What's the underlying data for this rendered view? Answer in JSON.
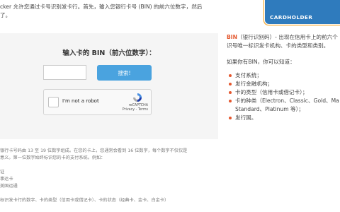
{
  "intro": {
    "line1": "cker 允许您通过卡号识别发卡行。首先，输入您银行卡号 (BIN) 的前六位数字，然后",
    "line2": "了。"
  },
  "form": {
    "title": "输入卡的 BIN（前六位数字）：",
    "bin_value": "",
    "search_label": "搜索!",
    "recaptcha_label": "I'm not a robot",
    "recaptcha_brand": "reCAPTCHA",
    "recaptcha_links": "Privacy - Terms"
  },
  "note": {
    "lines": [
      "银行卡号码由 13 至 19 位数字组成。在您的卡上，您通常会看到 16 位数字，每个数字不仅仅是",
      "意义。第一位数字始终标识您的卡的支付系统。例如：",
      "",
      "证",
      "事达卡",
      "美国运通",
      "",
      "标识发卡行的数字、卡的类型（信用卡或借记卡）、卡的状态（经典卡、金卡、白金卡）"
    ]
  },
  "card": {
    "label": "CARDHOLDER"
  },
  "sidebar": {
    "bin_term": "BIN",
    "desc_rest": "（银行识别码）- 出现在信用卡上的前六个",
    "desc_line2": "识号唯一标识发卡机构、卡的类型和类别。",
    "subtitle": "如果你有BIN，你可以知道：",
    "items": [
      "支付系统；",
      "发行金融机构；",
      "卡的类型（信用卡或借记卡）；",
      "卡的种类（Electron、Classic、Gold、Ma",
      "Standard、Platinum 等）；",
      "发行国。"
    ]
  },
  "colors": {
    "accent": "#e4572e",
    "button": "#4aa3df",
    "card": "#2f7bbd",
    "card_border": "#f39c12"
  }
}
